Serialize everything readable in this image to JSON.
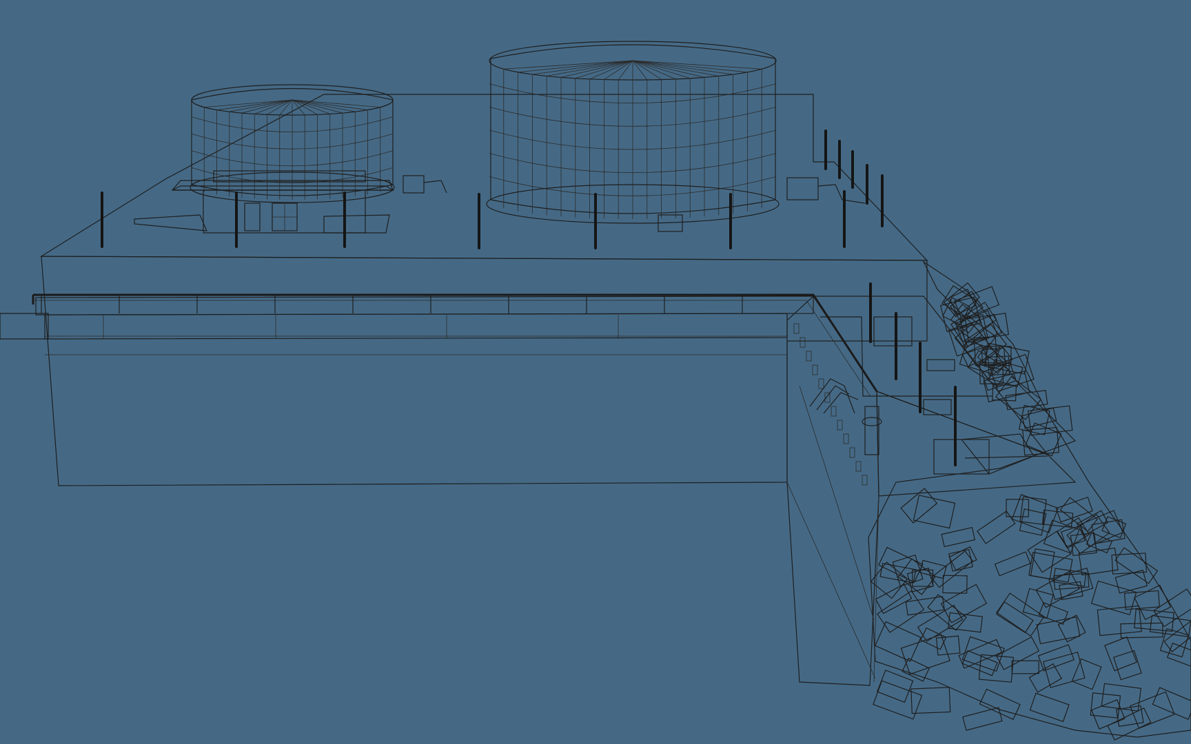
{
  "scene": {
    "background_color": "#456985",
    "model_fill": "#6f6f6f",
    "model_fill_dark": "#5e5e5e",
    "model_fill_light": "#7a7a7a",
    "wire_color": "#1e1e1e"
  }
}
